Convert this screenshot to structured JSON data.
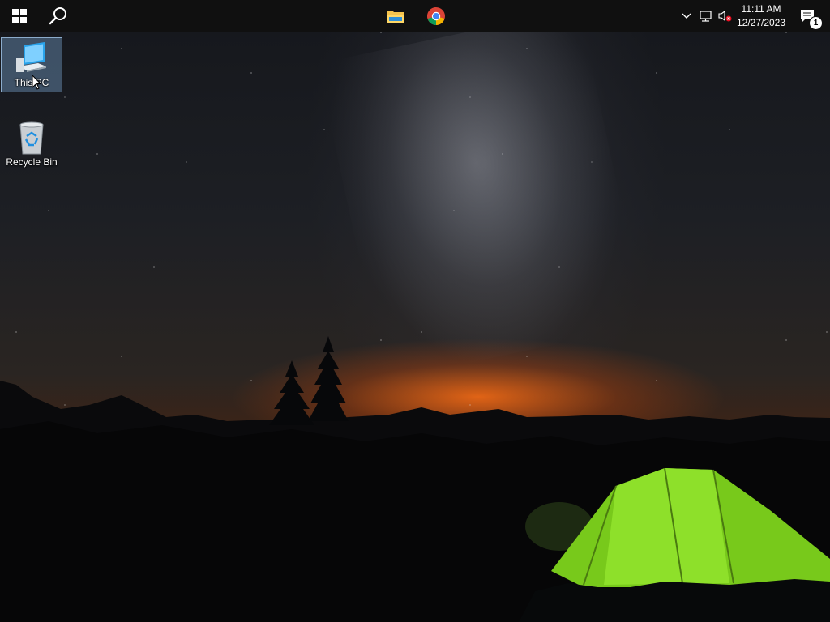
{
  "taskbar": {
    "start_icon": "windows-logo-icon",
    "search_icon": "search-icon",
    "pinned": [
      {
        "name": "File Explorer",
        "icon": "folder-icon"
      },
      {
        "name": "Google Chrome",
        "icon": "chrome-icon"
      }
    ],
    "tray": {
      "chevron_icon": "chevron-up-icon",
      "network_icon": "network-icon",
      "volume_icon": "volume-muted-icon",
      "time": "11:11 AM",
      "date": "12/27/2023",
      "notification_count": "1"
    },
    "colors": {
      "taskbar_bg": "#101010"
    }
  },
  "desktop": {
    "icons": [
      {
        "label": "This PC",
        "icon": "computer-icon",
        "selected": true
      },
      {
        "label": "Recycle Bin",
        "icon": "recycle-bin-icon",
        "selected": false
      }
    ]
  },
  "wallpaper": {
    "scene": "night sky with milky way, mountain silhouettes, pine trees, green glowing tent",
    "colors": {
      "glow": "#ff6a14",
      "tent": "#7cd31a"
    }
  }
}
